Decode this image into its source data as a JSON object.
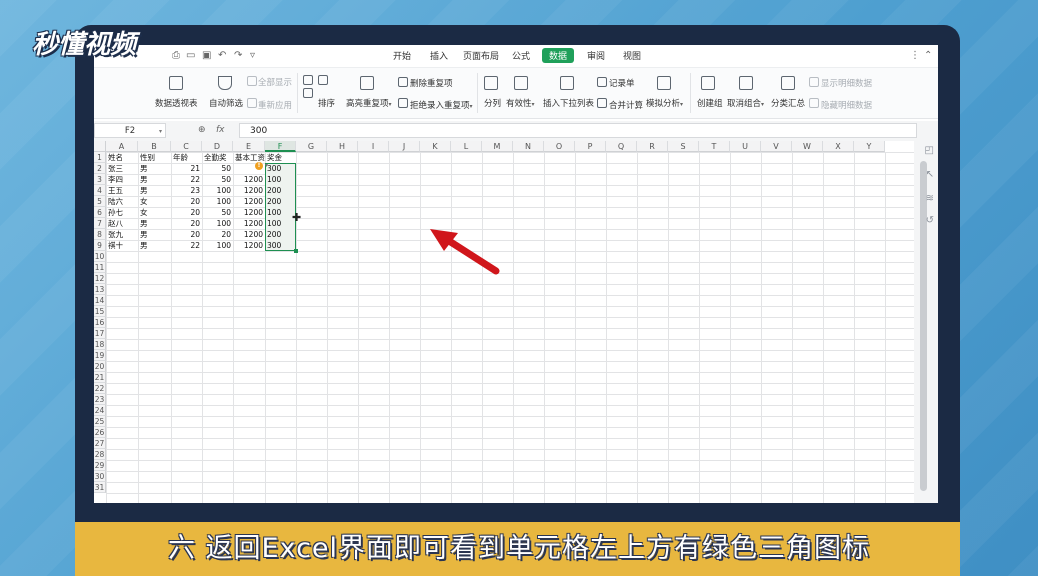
{
  "logo": {
    "text": "秒懂视频"
  },
  "caption": "六 返回Excel界面即可看到单元格左上方有绿色三角图标",
  "menu_tabs": [
    {
      "label": "开始",
      "active": false
    },
    {
      "label": "插入",
      "active": false
    },
    {
      "label": "页面布局",
      "active": false
    },
    {
      "label": "公式",
      "active": false
    },
    {
      "label": "数据",
      "active": true
    },
    {
      "label": "审阅",
      "active": false
    },
    {
      "label": "视图",
      "active": false
    }
  ],
  "ribbon": {
    "pivot_table": "数据透视表",
    "auto_filter": "自动筛选",
    "show_all": "全部显示",
    "reapply": "重新应用",
    "sort": "排序",
    "highlight_duplicates": "高亮重复项",
    "delete_duplicates": "删除重复项",
    "reject_duplicates": "拒绝录入重复项",
    "split_column": "分列",
    "validity": "有效性",
    "insert_dropdown": "插入下拉列表",
    "record_sheet": "记录单",
    "consolidate": "合并计算",
    "what_if": "模拟分析",
    "create_group": "创建组",
    "ungroup": "取消组合",
    "subtotal": "分类汇总",
    "show_detail": "显示明细数据",
    "hide_detail": "隐藏明细数据"
  },
  "formula_bar": {
    "name_box": "F2",
    "fx_label": "fx",
    "value": "300"
  },
  "columns": [
    "A",
    "B",
    "C",
    "D",
    "E",
    "F",
    "G",
    "H",
    "I",
    "J",
    "K",
    "L",
    "M",
    "N",
    "O",
    "P",
    "Q",
    "R",
    "S",
    "T",
    "U",
    "V",
    "W",
    "X",
    "Y"
  ],
  "rows": [
    "1",
    "2",
    "3",
    "4",
    "5",
    "6",
    "7",
    "8",
    "9",
    "10",
    "11",
    "12",
    "13",
    "14",
    "15",
    "16",
    "17",
    "18",
    "19",
    "20",
    "21",
    "22",
    "23",
    "24",
    "25",
    "26",
    "27",
    "28",
    "29",
    "30",
    "31"
  ],
  "table": {
    "headers": [
      "姓名",
      "性别",
      "年龄",
      "全勤奖",
      "基本工资",
      "奖金"
    ],
    "rows": [
      [
        "张三",
        "男",
        "21",
        "50",
        "",
        "300"
      ],
      [
        "李四",
        "男",
        "22",
        "50",
        "1200",
        "100"
      ],
      [
        "王五",
        "男",
        "23",
        "100",
        "1200",
        "200"
      ],
      [
        "陆六",
        "女",
        "20",
        "100",
        "1200",
        "200"
      ],
      [
        "孙七",
        "女",
        "20",
        "50",
        "1200",
        "100"
      ],
      [
        "赵八",
        "男",
        "20",
        "100",
        "1200",
        "100"
      ],
      [
        "张九",
        "男",
        "20",
        "20",
        "1200",
        "200"
      ],
      [
        "祺十",
        "男",
        "22",
        "100",
        "1200",
        "300"
      ]
    ]
  },
  "warning_icon": {
    "text": "!",
    "icon": "warning-icon"
  },
  "colors": {
    "accent": "#1fa05a",
    "arrow": "#d0161b",
    "caption_band": "#e8b73f"
  }
}
